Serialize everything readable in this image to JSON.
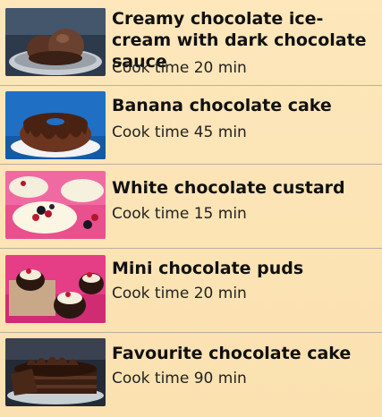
{
  "recipes": [
    {
      "title": "Creamy chocolate ice-cream with dark chocolate sauce",
      "cook_time": "Cook time 20 min",
      "image": "chocolate-ice-cream-photo"
    },
    {
      "title": "Banana chocolate cake",
      "cook_time": "Cook time 45 min",
      "image": "bundt-cake-photo"
    },
    {
      "title": "White chocolate custard",
      "cook_time": "Cook time 15 min",
      "image": "custard-berries-photo"
    },
    {
      "title": "Mini chocolate puds",
      "cook_time": "Cook time 20 min",
      "image": "mini-puddings-photo"
    },
    {
      "title": "Favourite chocolate cake",
      "cook_time": "Cook time 90 min",
      "image": "layer-cake-photo"
    }
  ],
  "colors": {
    "background": "#fbe3b4",
    "divider": "#b9b09e",
    "title_text": "#111111",
    "meta_text": "#222222"
  }
}
